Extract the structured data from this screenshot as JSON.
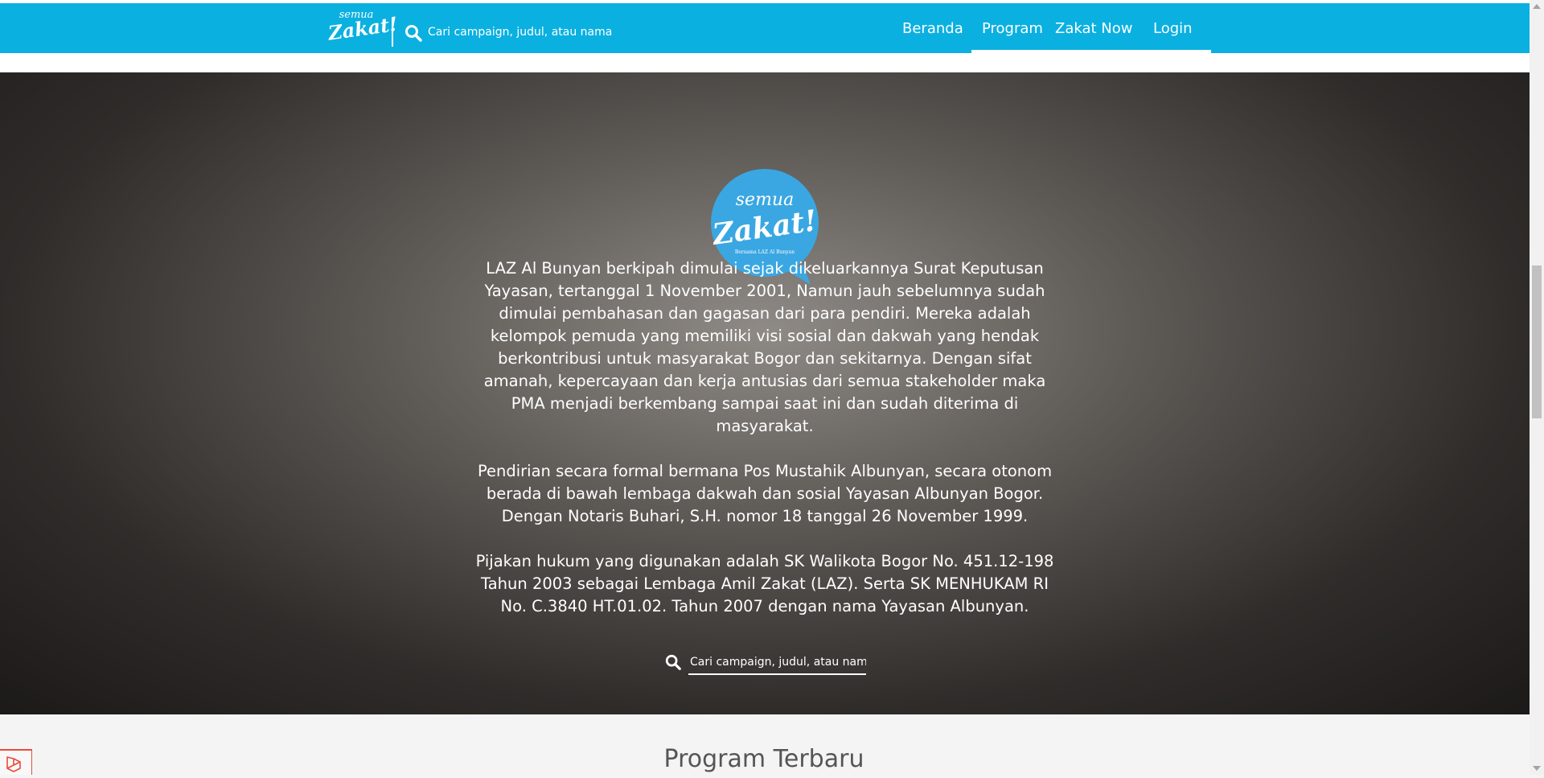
{
  "navbar": {
    "logo_line1": "semua",
    "logo_line2": "Zakat!",
    "search_placeholder": "Cari campaign, judul, atau nama",
    "menu": [
      {
        "label": "Beranda",
        "active": true
      },
      {
        "label": "Program",
        "active": false
      },
      {
        "label": "Zakat Now",
        "active": false
      },
      {
        "label": "Login",
        "active": false
      }
    ]
  },
  "hero": {
    "logo_line1": "semua",
    "logo_line2": "Zakat!",
    "logo_line3": "Bersama LAZ Al Bunyan",
    "paragraphs": [
      "LAZ Al Bunyan berkipah dimulai sejak dikeluarkannya Surat Keputusan Yayasan, tertanggal 1 November 2001, Namun jauh sebelumnya sudah dimulai pembahasan dan gagasan dari para pendiri. Mereka adalah kelompok pemuda yang memiliki visi sosial dan dakwah yang hendak berkontribusi untuk masyarakat Bogor dan sekitarnya. Dengan sifat amanah, kepercayaan dan kerja antusias dari semua stakeholder maka PMA menjadi berkembang sampai saat ini dan sudah diterima di masyarakat.",
      "Pendirian secara formal bermana Pos Mustahik Albunyan, secara otonom berada di bawah lembaga dakwah dan sosial Yayasan Albunyan Bogor. Dengan Notaris Buhari, S.H. nomor 18 tanggal 26 November 1999.",
      "Pijakan hukum yang digunakan adalah SK Walikota Bogor No. 451.12-198 Tahun 2003 sebagai Lembaga Amil Zakat (LAZ). Serta SK MENHUKAM RI No. C.3840 HT.01.02. Tahun 2007 dengan nama Yayasan Albunyan."
    ],
    "search_placeholder": "Cari campaign, judul, atau nama"
  },
  "section": {
    "title": "Program Terbaru"
  },
  "icons": {
    "search": "search-icon",
    "laravel": "laravel-icon"
  },
  "colors": {
    "brand": "#0ab0e0",
    "logo_blue": "#3aa7e2"
  }
}
